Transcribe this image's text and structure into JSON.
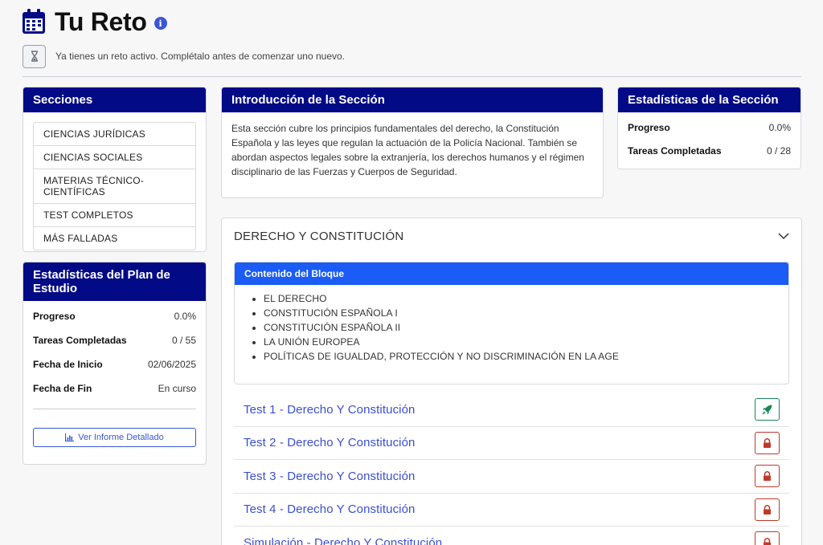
{
  "header": {
    "title": "Tu Reto",
    "info_glyph": "i",
    "icon": "calendar-icon"
  },
  "alert": {
    "icon": "hourglass-icon",
    "text": "Ya tienes un reto activo. Complétalo antes de comenzar uno nuevo."
  },
  "sections": {
    "title": "Secciones",
    "items": [
      {
        "label": "CIENCIAS JURÍDICAS"
      },
      {
        "label": "CIENCIAS SOCIALES"
      },
      {
        "label": "MATERIAS TÉCNICO-CIENTÍFICAS"
      },
      {
        "label": "TEST COMPLETOS"
      },
      {
        "label": "MÁS FALLADAS"
      }
    ]
  },
  "plan_stats": {
    "title": "Estadísticas del Plan de Estudio",
    "progress_label": "Progreso",
    "progress_value": "0.0%",
    "tasks_label": "Tareas Completadas",
    "tasks_value": "0 / 55",
    "start_label": "Fecha de Inicio",
    "start_value": "02/06/2025",
    "end_label": "Fecha de Fin",
    "end_value": "En curso",
    "report_button": "Ver Informe Detallado"
  },
  "intro": {
    "title": "Introducción de la Sección",
    "text": "Esta sección cubre los principios fundamentales del derecho, la Constitución Española y las leyes que regulan la actuación de la Policía Nacional. También se abordan aspectos legales sobre la extranjería, los derechos humanos y el régimen disciplinario de las Fuerzas y Cuerpos de Seguridad."
  },
  "section_stats": {
    "title": "Estadísticas de la Sección",
    "progress_label": "Progreso",
    "progress_value": "0.0%",
    "tasks_label": "Tareas Completadas",
    "tasks_value": "0 / 28"
  },
  "block": {
    "title": "DERECHO Y CONSTITUCIÓN",
    "content_title": "Contenido del Bloque",
    "content_items": [
      "EL DERECHO",
      "CONSTITUCIÓN ESPAÑOLA I",
      "CONSTITUCIÓN ESPAÑOLA II",
      "LA UNIÓN EUROPEA",
      "POLÍTICAS DE IGUALDAD, PROTECCIÓN Y NO DISCRIMINACIÓN EN LA AGE"
    ],
    "tests": [
      {
        "label": "Test 1 - Derecho Y Constitución",
        "icon": "rocket-icon",
        "state": "start"
      },
      {
        "label": "Test 2 - Derecho Y Constitución",
        "icon": "lock-icon",
        "state": "locked"
      },
      {
        "label": "Test 3 - Derecho Y Constitución",
        "icon": "lock-icon",
        "state": "locked"
      },
      {
        "label": "Test 4 - Derecho Y Constitución",
        "icon": "lock-icon",
        "state": "locked"
      },
      {
        "label": "Simulación - Derecho Y Constitución",
        "icon": "lock-icon",
        "state": "locked"
      }
    ]
  },
  "colors": {
    "header_navy": "#030a86",
    "content_blue": "#1a5cf5",
    "link_blue": "#3b4fd0",
    "start_green": "#198754",
    "lock_red": "#c0392b"
  }
}
